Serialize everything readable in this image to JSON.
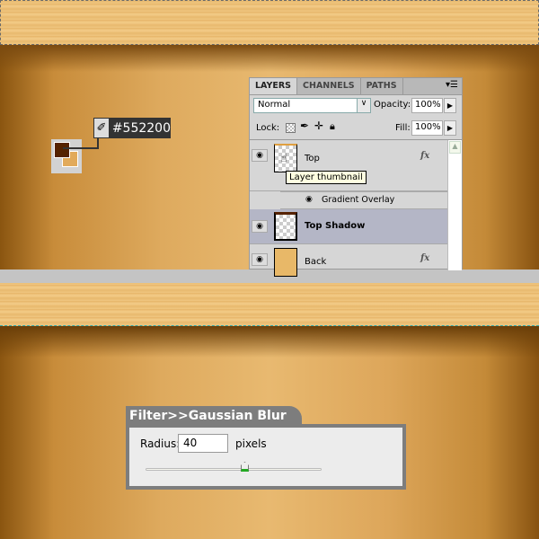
{
  "color_picker": {
    "hex": "#552200",
    "foreground": "#552200",
    "background": "#e2aa5a",
    "icon": "eyedropper-icon"
  },
  "layers_panel": {
    "tabs": [
      "LAYERS",
      "CHANNELS",
      "PATHS"
    ],
    "blend_mode": "Normal",
    "opacity_label": "Opacity:",
    "opacity": "100%",
    "lock_label": "Lock:",
    "fill_label": "Fill:",
    "fill": "100%",
    "layers": [
      {
        "name": "Top",
        "fx": "fx",
        "selected": false
      },
      {
        "name": "Top Shadow",
        "selected": true
      },
      {
        "name": "Back",
        "fx": "fx",
        "selected": false
      }
    ],
    "effect": "Gradient Overlay",
    "tooltip": "Layer thumbnail"
  },
  "dialog": {
    "title": "Filter>>Gaussian Blur",
    "radius_label": "Radius:",
    "radius": "40",
    "unit": "pixels",
    "slider_fraction": 0.6
  }
}
